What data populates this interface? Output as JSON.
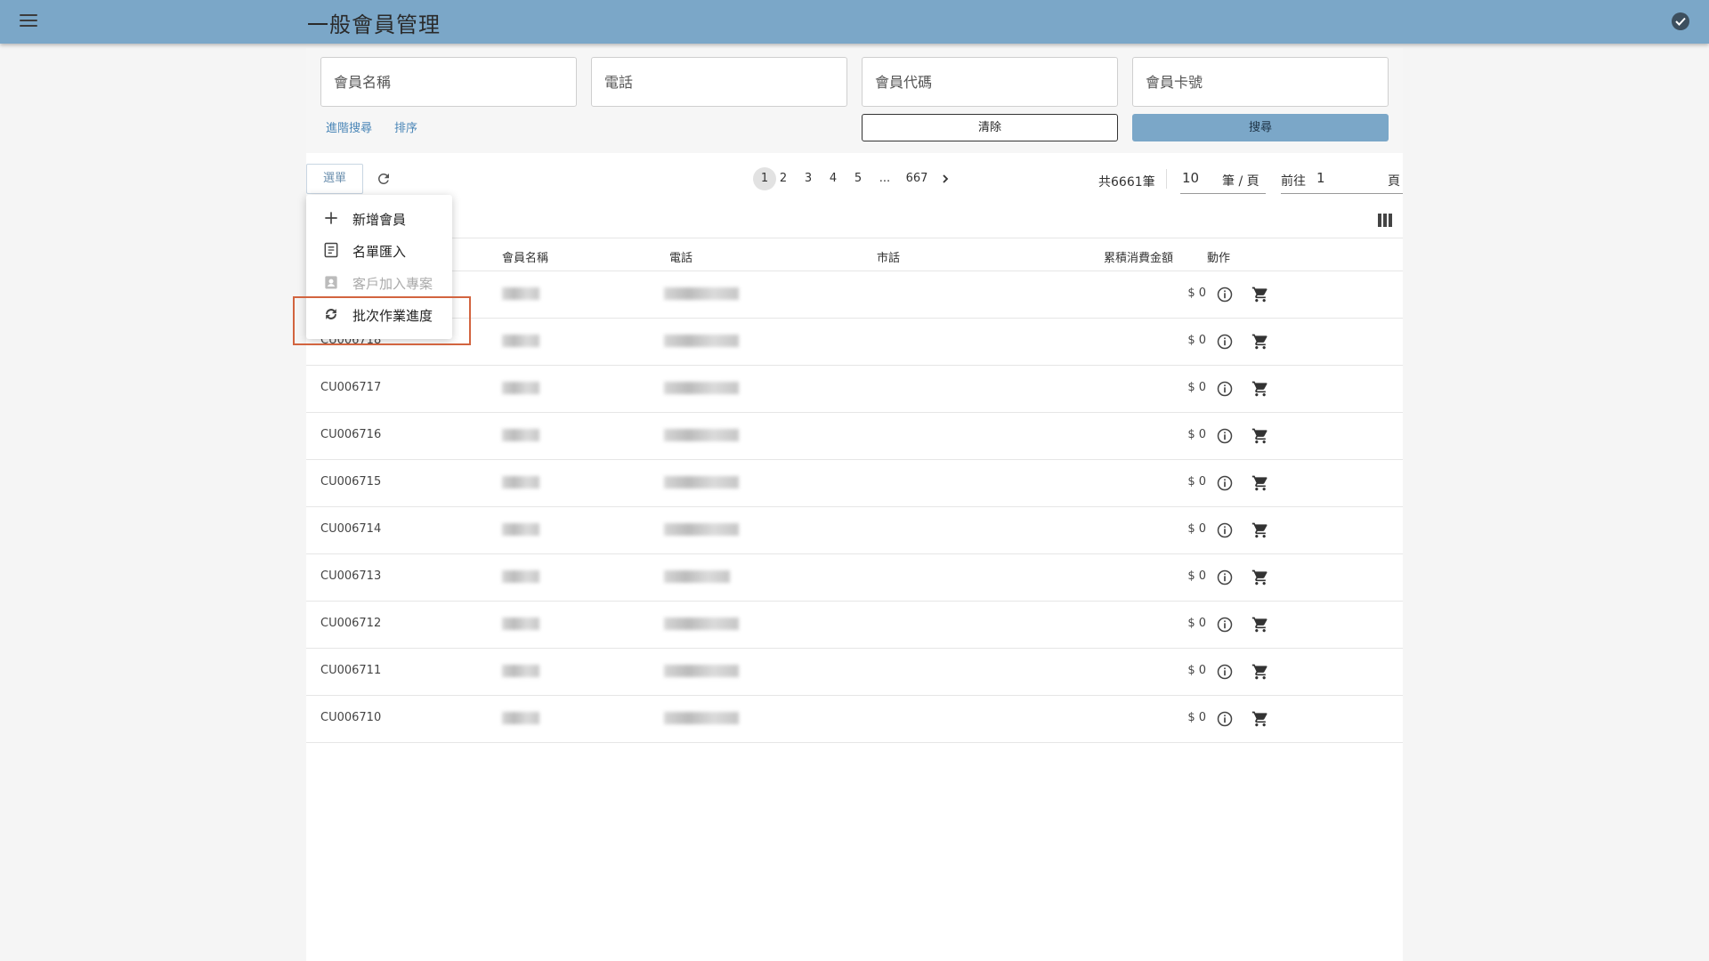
{
  "header": {
    "title": "一般會員管理"
  },
  "search": {
    "fields": [
      {
        "placeholder": "會員名稱"
      },
      {
        "placeholder": "電話"
      },
      {
        "placeholder": "會員代碼"
      },
      {
        "placeholder": "會員卡號"
      }
    ],
    "advanced_link": "進階搜尋",
    "sort_link": "排序",
    "clear_button": "清除",
    "search_button": "搜尋"
  },
  "toolbar": {
    "menu_button": "選單",
    "pages": [
      "1",
      "2",
      "3",
      "4",
      "5",
      "...",
      "667"
    ],
    "current_page": "1",
    "next_icon": "chevron-right-icon",
    "total": "共6661筆",
    "per_page_value": "10",
    "per_page_unit": "筆 / 頁",
    "goto_label": "前往",
    "goto_value": "1",
    "goto_unit": "頁"
  },
  "dropdown": {
    "items": [
      {
        "label": "新增會員",
        "icon": "plus-icon",
        "disabled": false
      },
      {
        "label": "名單匯入",
        "icon": "import-icon",
        "disabled": false
      },
      {
        "label": "客戶加入專案",
        "icon": "badge-icon",
        "disabled": true
      },
      {
        "label": "批次作業進度",
        "icon": "sync-icon",
        "disabled": false
      }
    ]
  },
  "table": {
    "columns": [
      "會員名稱",
      "電話",
      "市話",
      "累積消費金額",
      "動作"
    ],
    "rows": [
      {
        "code": "",
        "amount": "$ 0"
      },
      {
        "code": "CU006718",
        "amount": "$ 0"
      },
      {
        "code": "CU006717",
        "amount": "$ 0"
      },
      {
        "code": "CU006716",
        "amount": "$ 0"
      },
      {
        "code": "CU006715",
        "amount": "$ 0"
      },
      {
        "code": "CU006714",
        "amount": "$ 0"
      },
      {
        "code": "CU006713",
        "amount": "$ 0"
      },
      {
        "code": "CU006712",
        "amount": "$ 0"
      },
      {
        "code": "CU006711",
        "amount": "$ 0"
      },
      {
        "code": "CU006710",
        "amount": "$ 0"
      }
    ]
  },
  "colors": {
    "primary": "#7ba7c8",
    "highlight": "#d2643f"
  }
}
